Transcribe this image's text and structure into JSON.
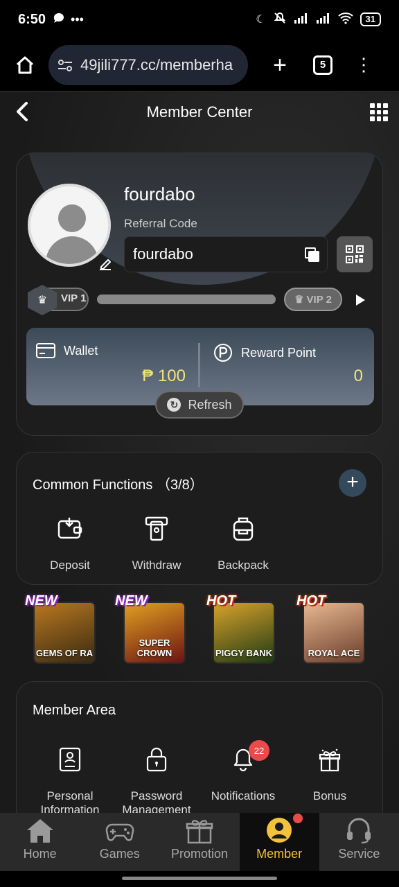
{
  "status": {
    "time": "6:50",
    "battery": "31"
  },
  "browser": {
    "url": "49jili777.cc/memberha",
    "tab_count": "5"
  },
  "header": {
    "title": "Member Center"
  },
  "profile": {
    "username": "fourdabo",
    "referral_label": "Referral Code",
    "referral_code": "fourdabo",
    "vip_current": "VIP 1",
    "vip_next": "VIP 2",
    "vip_progress": 0.0
  },
  "wallet": {
    "wallet_label": "Wallet",
    "wallet_amount": "₱ 100",
    "reward_label": "Reward Point",
    "reward_amount": "0",
    "refresh_label": "Refresh"
  },
  "common_functions": {
    "title": "Common Functions",
    "count": "（3/8）",
    "add": "+",
    "items": [
      {
        "label": "Deposit",
        "icon": "deposit-icon"
      },
      {
        "label": "Withdraw",
        "icon": "withdraw-icon"
      },
      {
        "label": "Backpack",
        "icon": "backpack-icon"
      }
    ]
  },
  "games": [
    {
      "tag": "NEW",
      "name": "GEMS OF RA",
      "color_a": "#3a2a12",
      "color_b": "#b8781f"
    },
    {
      "tag": "NEW",
      "name": "SUPER CROWN",
      "color_a": "#6b1414",
      "color_b": "#e0a020"
    },
    {
      "tag": "HOT",
      "name": "PIGGY BANK",
      "color_a": "#1f3a14",
      "color_b": "#d8a22a"
    },
    {
      "tag": "HOT",
      "name": "ROYAL ACE",
      "color_a": "#6a3c2a",
      "color_b": "#e8b890"
    }
  ],
  "member_area": {
    "title": "Member Area",
    "items": [
      {
        "label": "Personal\nInformation",
        "icon": "personal-info-icon"
      },
      {
        "label": "Password\nManagement",
        "icon": "lock-icon"
      },
      {
        "label": "Notifications",
        "icon": "bell-icon",
        "badge": "22"
      },
      {
        "label": "Bonus",
        "icon": "gift-icon"
      }
    ]
  },
  "bottom_nav": {
    "items": [
      {
        "label": "Home",
        "icon": "home-icon"
      },
      {
        "label": "Games",
        "icon": "gamepad-icon"
      },
      {
        "label": "Promotion",
        "icon": "gift-icon"
      },
      {
        "label": "Member",
        "icon": "member-icon"
      },
      {
        "label": "Service",
        "icon": "headset-icon"
      }
    ]
  },
  "colors": {
    "accent": "#f3c23a",
    "wallet_amount": "#f3e37a",
    "badge": "#e94a4a"
  }
}
